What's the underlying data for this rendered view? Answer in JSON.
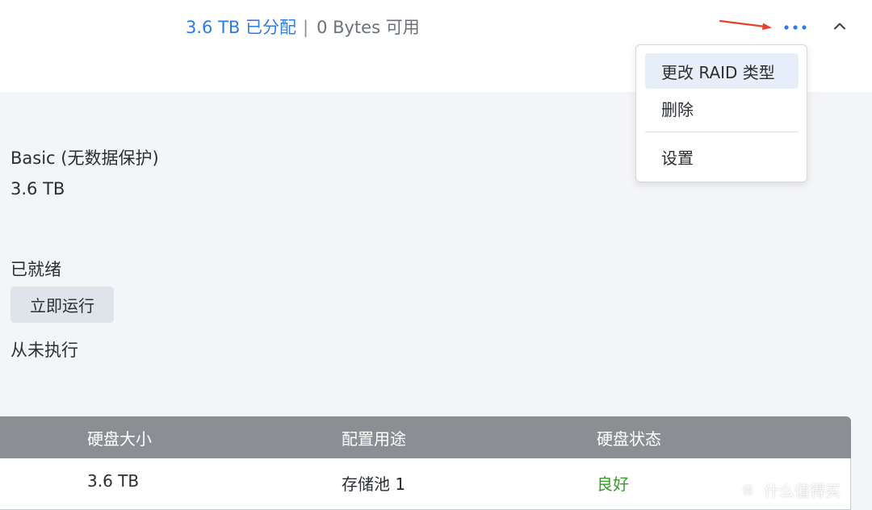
{
  "header": {
    "allocated": "3.6 TB 已分配",
    "separator": "|",
    "available": "0 Bytes 可用",
    "more_icon": "more-horizontal-icon",
    "collapse_icon": "chevron-up-icon",
    "accent_color": "#2d7be5",
    "annotation_arrow_color": "#e8412c"
  },
  "details": {
    "raid_type": "Basic (无数据保护)",
    "capacity": "3.6 TB",
    "check_status": "已就绪",
    "run_now_label": "立即运行",
    "last_run": "从未执行"
  },
  "disk_table": {
    "columns": [
      "硬盘大小",
      "配置用途",
      "硬盘状态"
    ],
    "rows": [
      {
        "size": "3.6 TB",
        "usage": "存储池 1",
        "status": "良好"
      }
    ],
    "header_bg": "#8b8f93",
    "status_good_color": "#3a9b2f"
  },
  "menu": {
    "items": [
      "更改 RAID 类型",
      "删除",
      "设置"
    ],
    "highlighted": "更改 RAID 类型"
  },
  "watermark": {
    "logo_char": "值",
    "text": "什么值得买"
  }
}
